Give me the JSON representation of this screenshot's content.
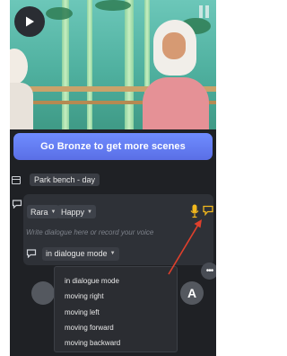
{
  "colors": {
    "app_bg": "#1f2125",
    "bronze_button": "#6179f5",
    "panel_bg": "#2e3137",
    "accent_yellow": "#f2b81d",
    "annotation_red": "#e0402c"
  },
  "video": {
    "play_icon": "play-icon"
  },
  "upgrade": {
    "label": "Go Bronze to get more scenes"
  },
  "scene": {
    "name": "Park bench - day"
  },
  "dialogue": {
    "character": "Rara",
    "emotion": "Happy",
    "voice_placeholder": "Write dialogue here or record your voice",
    "mode": "in dialogue mode"
  },
  "mode_menu": {
    "options": [
      "in dialogue mode",
      "moving right",
      "moving left",
      "moving forward",
      "moving backward"
    ]
  },
  "bottom": {
    "a_label": "A",
    "more_label": "•••"
  }
}
